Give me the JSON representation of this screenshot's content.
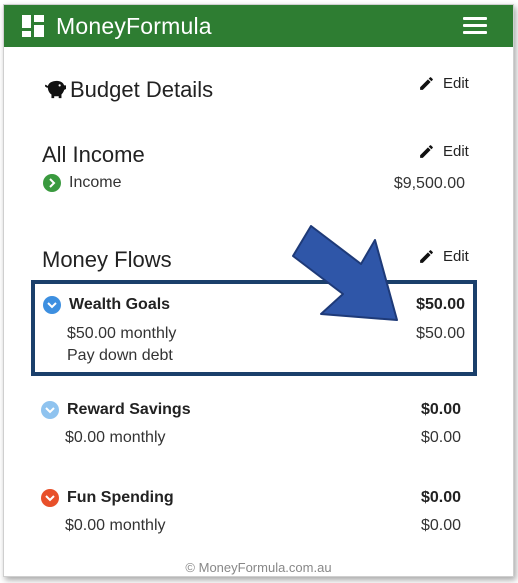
{
  "app": {
    "brand": "MoneyFormula"
  },
  "budget": {
    "title": "Budget Details",
    "edit_label": "Edit"
  },
  "income": {
    "title": "All Income",
    "edit_label": "Edit",
    "items": [
      {
        "label": "Income",
        "amount": "$9,500.00"
      }
    ]
  },
  "flows": {
    "title": "Money Flows",
    "edit_label": "Edit",
    "items": [
      {
        "name": "Wealth Goals",
        "total": "$50.00",
        "monthly": "$50.00 monthly",
        "monthly_amount": "$50.00",
        "note": "Pay down debt",
        "icon_color": "#3d8fe0"
      },
      {
        "name": "Reward Savings",
        "total": "$0.00",
        "monthly": "$0.00 monthly",
        "monthly_amount": "$0.00",
        "icon_color": "#8fc3ef"
      },
      {
        "name": "Fun Spending",
        "total": "$0.00",
        "monthly": "$0.00 monthly",
        "monthly_amount": "$0.00",
        "icon_color": "#e8502a"
      }
    ]
  },
  "footer": {
    "text": "© MoneyFormula.com.au"
  },
  "colors": {
    "brand_green": "#2e7d32",
    "income_green": "#3a9a3f",
    "highlight_blue": "#1a3f6b",
    "arrow_blue": "#2f56a8"
  }
}
